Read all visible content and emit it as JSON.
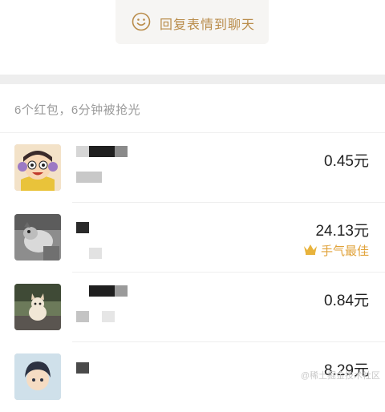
{
  "reply": {
    "label": "回复表情到聊天",
    "icon": "smile-icon"
  },
  "summary": {
    "text": "6个红包，6分钟被抢光"
  },
  "entries": [
    {
      "amount": "0.45元",
      "best": ""
    },
    {
      "amount": "24.13元",
      "best": "手气最佳"
    },
    {
      "amount": "0.84元",
      "best": ""
    },
    {
      "amount": "8.29元",
      "best": ""
    }
  ],
  "watermark": {
    "text": "@稀土掘金技术社区"
  },
  "colors": {
    "accent": "#b98c4a",
    "best": "#e0a239",
    "separator": "#eeeeee"
  }
}
